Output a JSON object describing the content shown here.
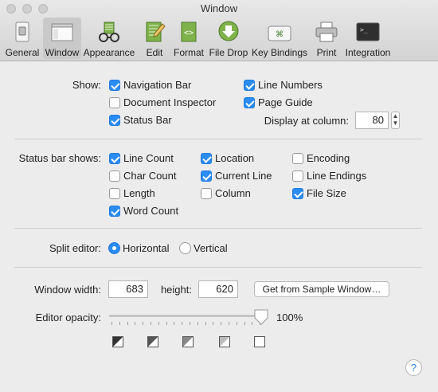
{
  "window": {
    "title": "Window"
  },
  "toolbar": {
    "items": [
      {
        "label": "General",
        "icon": "switch-icon"
      },
      {
        "label": "Window",
        "icon": "window-icon"
      },
      {
        "label": "Appearance",
        "icon": "glasses-icon"
      },
      {
        "label": "Edit",
        "icon": "edit-document-icon"
      },
      {
        "label": "Format",
        "icon": "format-document-icon"
      },
      {
        "label": "File Drop",
        "icon": "download-arrow-icon"
      },
      {
        "label": "Key Bindings",
        "icon": "keyboard-key-icon"
      },
      {
        "label": "Print",
        "icon": "printer-icon"
      },
      {
        "label": "Integration",
        "icon": "terminal-icon"
      }
    ],
    "selected": "Window"
  },
  "show": {
    "label": "Show:",
    "navigation_bar": {
      "label": "Navigation Bar",
      "checked": true
    },
    "document_inspector": {
      "label": "Document Inspector",
      "checked": false
    },
    "status_bar": {
      "label": "Status Bar",
      "checked": true
    },
    "line_numbers": {
      "label": "Line Numbers",
      "checked": true
    },
    "page_guide": {
      "label": "Page Guide",
      "checked": true
    },
    "display_at_column": {
      "label": "Display at column:",
      "value": "80"
    }
  },
  "status_bar_shows": {
    "label": "Status bar shows:",
    "line_count": {
      "label": "Line Count",
      "checked": true
    },
    "char_count": {
      "label": "Char Count",
      "checked": false
    },
    "length": {
      "label": "Length",
      "checked": false
    },
    "word_count": {
      "label": "Word Count",
      "checked": true
    },
    "location": {
      "label": "Location",
      "checked": true
    },
    "current_line": {
      "label": "Current Line",
      "checked": true
    },
    "column": {
      "label": "Column",
      "checked": false
    },
    "encoding": {
      "label": "Encoding",
      "checked": false
    },
    "line_endings": {
      "label": "Line Endings",
      "checked": false
    },
    "file_size": {
      "label": "File Size",
      "checked": true
    }
  },
  "split_editor": {
    "label": "Split editor:",
    "horizontal": {
      "label": "Horizontal",
      "selected": true
    },
    "vertical": {
      "label": "Vertical",
      "selected": false
    }
  },
  "window_size": {
    "width_label": "Window width:",
    "width_value": "683",
    "height_label": "height:",
    "height_value": "620",
    "sample_button": "Get from Sample Window…"
  },
  "editor_opacity": {
    "label": "Editor opacity:",
    "value_text": "100%",
    "level": 1.0
  },
  "help": {
    "label": "?"
  },
  "colors": {
    "accent": "#2b8cf2",
    "background": "#ececec"
  }
}
